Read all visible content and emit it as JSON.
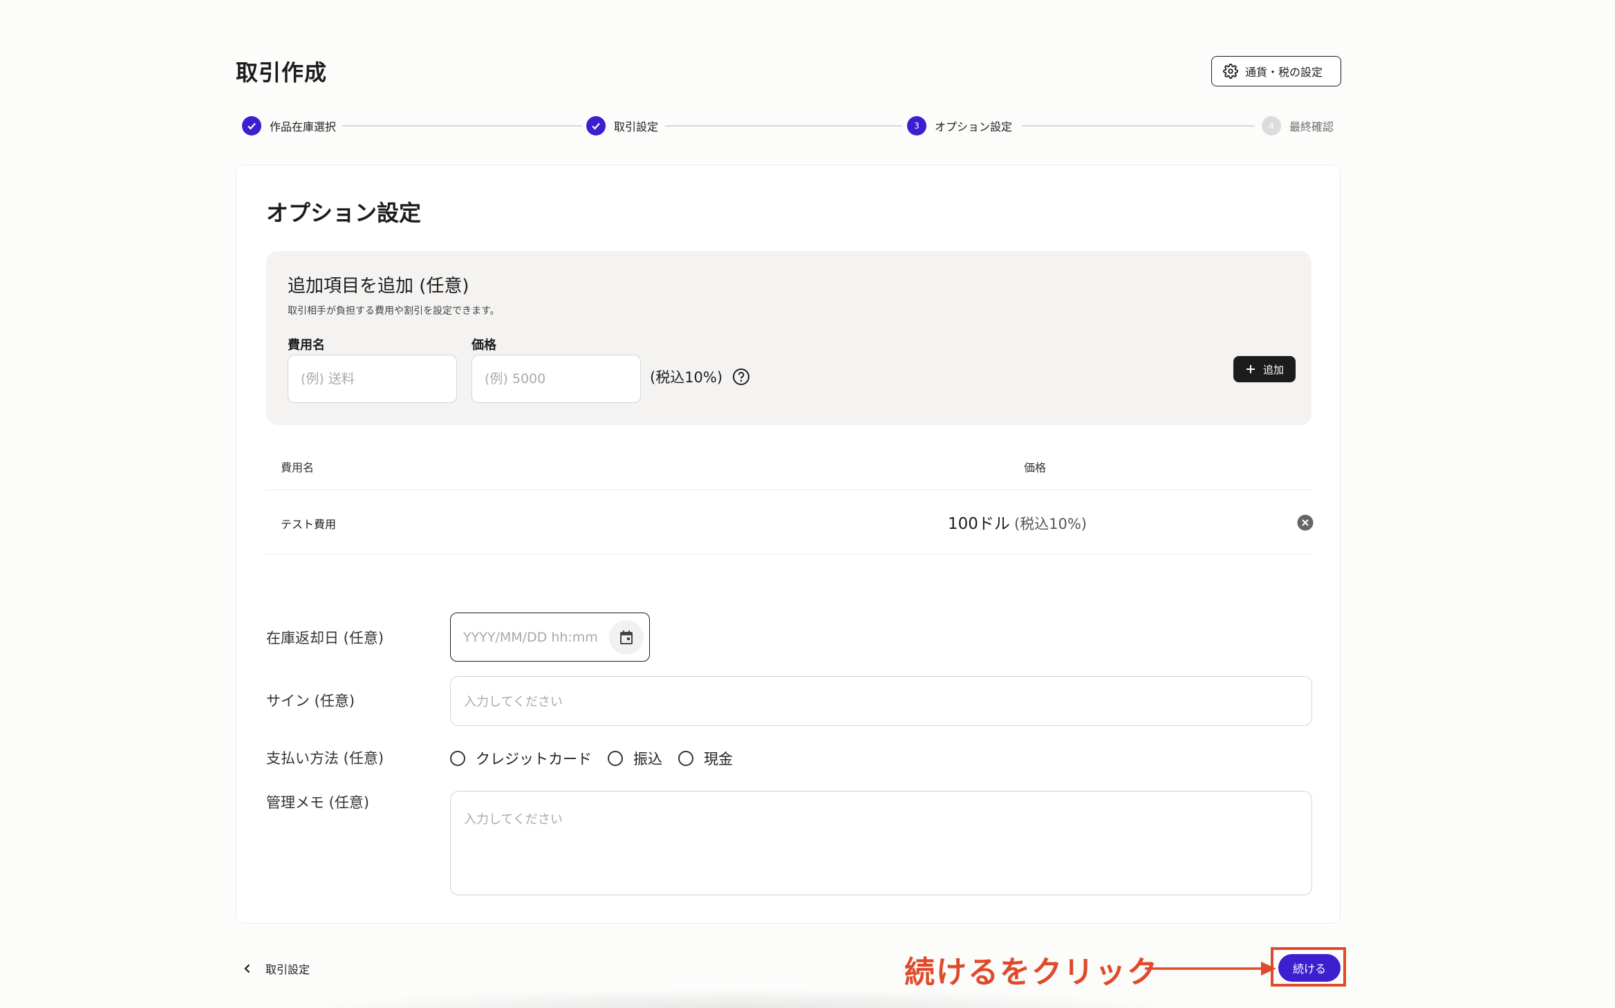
{
  "header": {
    "title": "取引作成",
    "settings_label": "通貨・税の設定",
    "settings_icon": "gear-icon"
  },
  "stepper": {
    "steps": [
      {
        "label": "作品在庫選択",
        "state": "done",
        "number": ""
      },
      {
        "label": "取引設定",
        "state": "done",
        "number": ""
      },
      {
        "label": "オプション設定",
        "state": "current",
        "number": "3"
      },
      {
        "label": "最終確認",
        "state": "todo",
        "number": "4"
      }
    ]
  },
  "section": {
    "title": "オプション設定"
  },
  "additional_items": {
    "title": "追加項目を追加 (任意)",
    "description": "取引相手が負担する費用や割引を設定できます。",
    "fee_name_label": "費用名",
    "fee_name_placeholder": "(例) 送料",
    "price_label": "価格",
    "price_placeholder": "(例) 5000",
    "tax_note": "(税込10%)",
    "add_button_label": "追加"
  },
  "fee_table": {
    "headers": {
      "name": "費用名",
      "price": "価格"
    },
    "rows": [
      {
        "name": "テスト費用",
        "price": "100ドル",
        "tax": "(税込10%)"
      }
    ]
  },
  "form": {
    "return_date_label": "在庫返却日 (任意)",
    "return_date_placeholder": "YYYY/MM/DD hh:mm",
    "signature_label": "サイン (任意)",
    "signature_placeholder": "入力してください",
    "payment_label": "支払い方法 (任意)",
    "payment_options": [
      "クレジットカード",
      "振込",
      "現金"
    ],
    "memo_label": "管理メモ (任意)",
    "memo_placeholder": "入力してください"
  },
  "footer": {
    "back_label": "取引設定",
    "continue_label": "続ける",
    "annotation": "続けるをクリック"
  },
  "colors": {
    "accent": "#3d1fd0",
    "annotation": "#e04a2a",
    "dark_button": "#1c1c1c"
  }
}
